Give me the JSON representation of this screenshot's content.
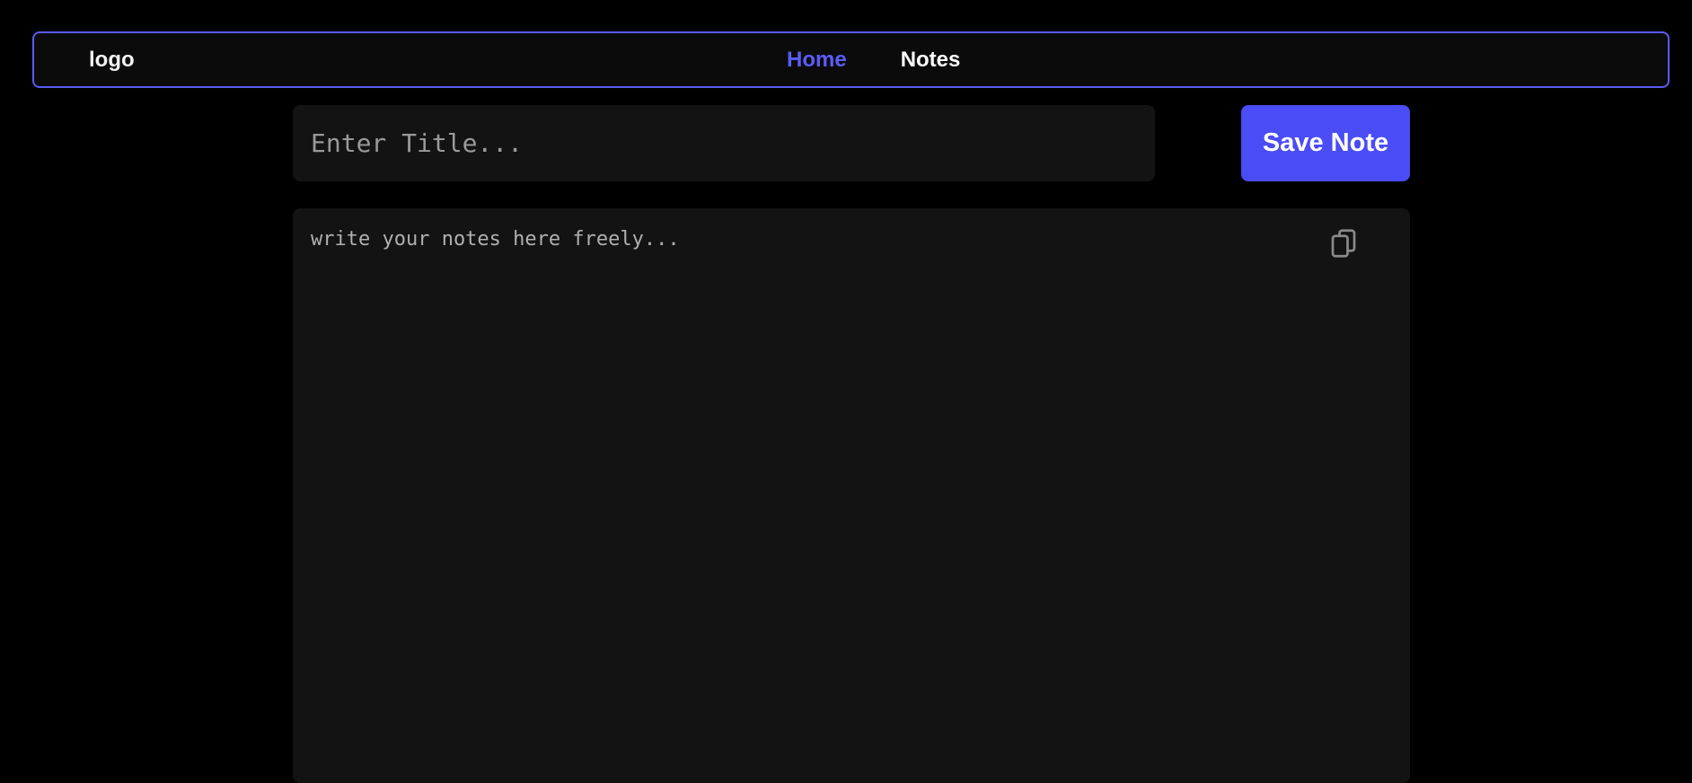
{
  "navbar": {
    "logo": "logo",
    "links": [
      {
        "label": "Home",
        "active": true
      },
      {
        "label": "Notes",
        "active": false
      }
    ]
  },
  "editor": {
    "title_placeholder": "Enter Title...",
    "title_value": "",
    "save_label": "Save Note",
    "notes_placeholder": "write your notes here freely...",
    "notes_value": "",
    "copy_icon": "copy-icon"
  },
  "colors": {
    "accent": "#4a4cf5",
    "nav_border": "#5a5bf0",
    "active_link": "#5b5cf6",
    "background": "#000000",
    "panel": "#131313"
  }
}
